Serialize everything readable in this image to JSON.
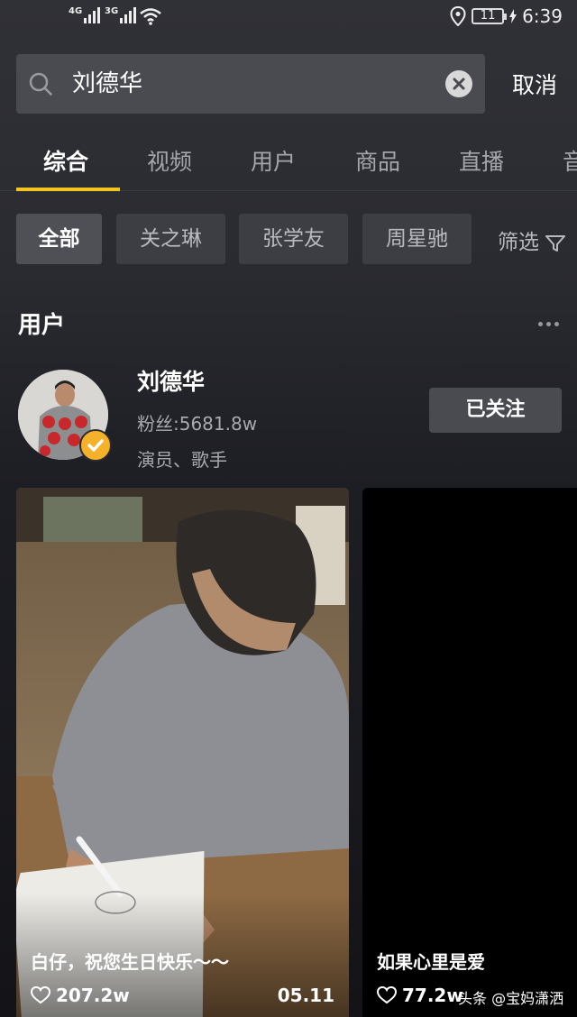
{
  "status_bar": {
    "net1": "4G",
    "net2": "3G",
    "battery": "11",
    "time": "6:39"
  },
  "search": {
    "query": "刘德华",
    "cancel_label": "取消"
  },
  "tabs": [
    "综合",
    "视频",
    "用户",
    "商品",
    "直播",
    "音"
  ],
  "chips": [
    "全部",
    "关之琳",
    "张学友",
    "周星驰"
  ],
  "filter_label": "筛选",
  "users_section": {
    "title": "用户",
    "user": {
      "name": "刘德华",
      "fans": "粉丝:5681.8w",
      "tags": "演员、歌手",
      "follow_label": "已关注"
    }
  },
  "videos": [
    {
      "title": "白仔，祝您生日快乐～～",
      "likes": "207.2w",
      "date": "05.11"
    },
    {
      "title": "如果心里是爱",
      "likes": "77.2w",
      "date": ""
    }
  ],
  "watermark": "头条 @宝妈潇洒",
  "colors": {
    "accent": "#f3c521",
    "verified": "#f6b12a"
  }
}
